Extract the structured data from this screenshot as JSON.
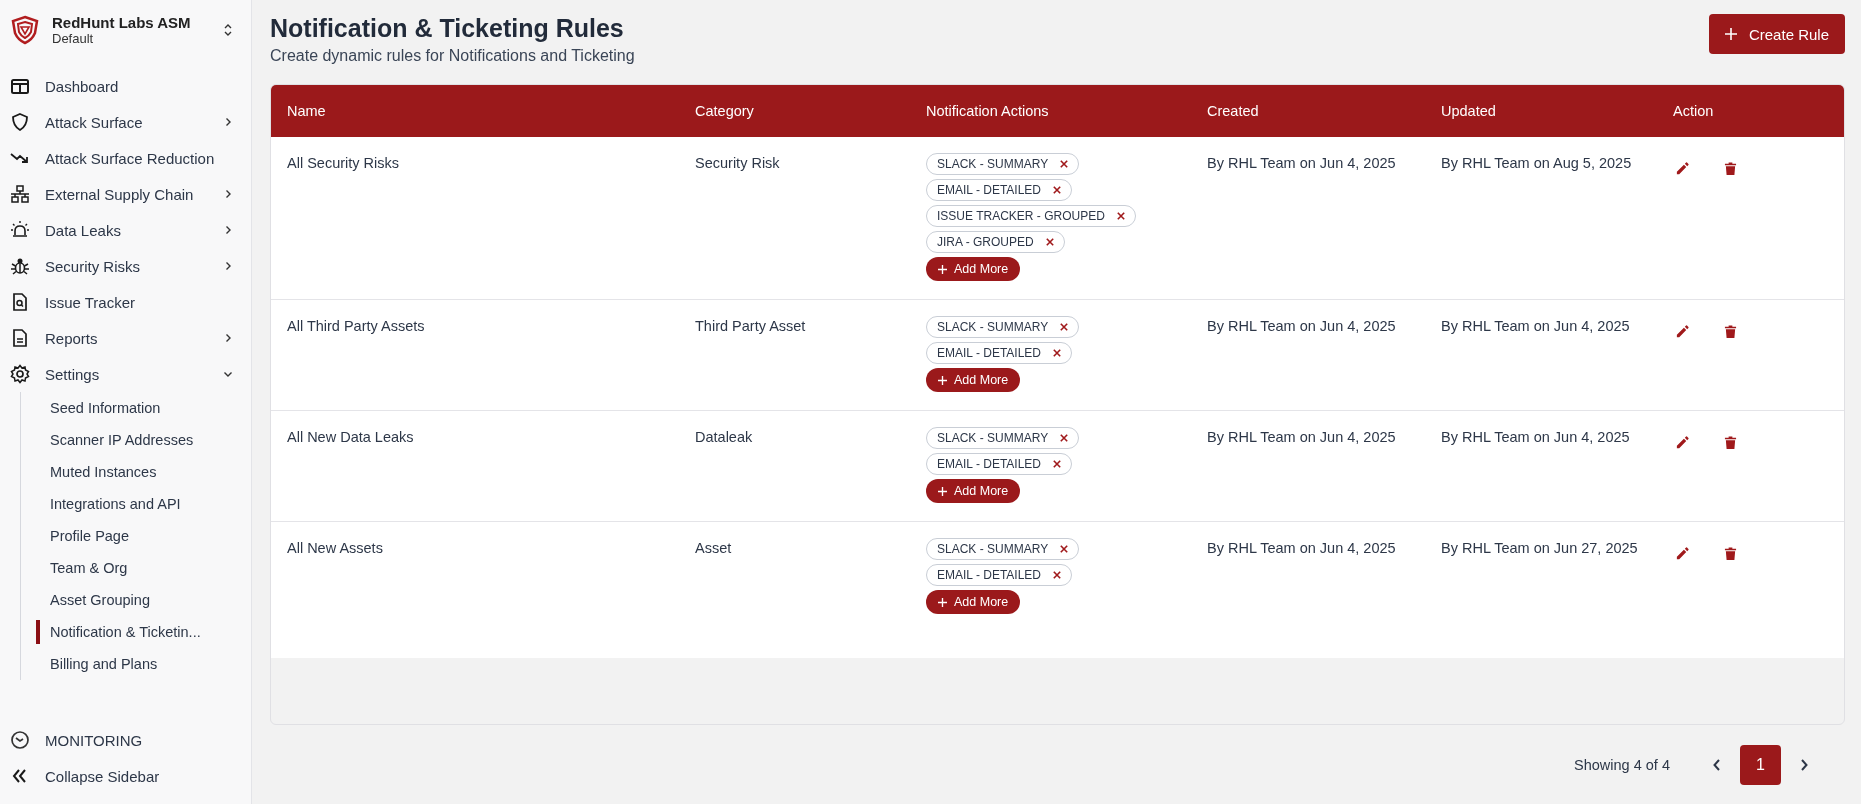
{
  "brand": {
    "name": "RedHunt Labs ASM",
    "workspace": "Default"
  },
  "sidebar": {
    "items": [
      {
        "label": "Dashboard",
        "kind": "link"
      },
      {
        "label": "Attack Surface",
        "kind": "group",
        "expanded": false
      },
      {
        "label": "Attack Surface Reduction",
        "kind": "link"
      },
      {
        "label": "External Supply Chain",
        "kind": "group",
        "expanded": false
      },
      {
        "label": "Data Leaks",
        "kind": "group",
        "expanded": false
      },
      {
        "label": "Security Risks",
        "kind": "group",
        "expanded": false
      },
      {
        "label": "Issue Tracker",
        "kind": "link"
      },
      {
        "label": "Reports",
        "kind": "group",
        "expanded": false
      },
      {
        "label": "Settings",
        "kind": "group",
        "expanded": true,
        "children": [
          {
            "label": "Seed Information",
            "selected": false
          },
          {
            "label": "Scanner IP Addresses",
            "selected": false
          },
          {
            "label": "Muted Instances",
            "selected": false
          },
          {
            "label": "Integrations and API",
            "selected": false
          },
          {
            "label": "Profile Page",
            "selected": false
          },
          {
            "label": "Team & Org",
            "selected": false
          },
          {
            "label": "Asset Grouping",
            "selected": false
          },
          {
            "label": "Notification & Ticketin...",
            "selected": true
          },
          {
            "label": "Billing and Plans",
            "selected": false
          }
        ]
      }
    ],
    "footer": [
      {
        "label": "MONITORING"
      },
      {
        "label": "Collapse Sidebar"
      }
    ]
  },
  "page": {
    "title": "Notification & Ticketing Rules",
    "subtitle": "Create dynamic rules for Notifications and Ticketing",
    "create_button": "Create Rule"
  },
  "table": {
    "columns": [
      "Name",
      "Category",
      "Notification Actions",
      "Created",
      "Updated",
      "Action"
    ],
    "rows": [
      {
        "name": "All Security Risks",
        "category": "Security Risk",
        "actions": [
          "SLACK - SUMMARY",
          "EMAIL - DETAILED",
          "ISSUE TRACKER - GROUPED",
          "JIRA - GROUPED"
        ],
        "add_button": "Add More",
        "created": "By RHL Team on Jun 4, 2025",
        "updated": "By RHL Team on Aug 5, 2025"
      },
      {
        "name": "All Third Party Assets",
        "category": "Third Party Asset",
        "actions": [
          "SLACK - SUMMARY",
          "EMAIL - DETAILED"
        ],
        "add_button": "Add More",
        "created": "By RHL Team on Jun 4, 2025",
        "updated": "By RHL Team on Jun 4, 2025"
      },
      {
        "name": "All New Data Leaks",
        "category": "Dataleak",
        "actions": [
          "SLACK - SUMMARY",
          "EMAIL - DETAILED"
        ],
        "add_button": "Add More",
        "created": "By RHL Team on Jun 4, 2025",
        "updated": "By RHL Team on Jun 4, 2025"
      },
      {
        "name": "All New Assets",
        "category": "Asset",
        "actions": [
          "SLACK - SUMMARY",
          "EMAIL - DETAILED"
        ],
        "add_button": "Add More",
        "created": "By RHL Team on Jun 4, 2025",
        "updated": "By RHL Team on Jun 27, 2025"
      }
    ]
  },
  "pagination": {
    "summary": "Showing 4 of 4",
    "pages": [
      {
        "label": "1",
        "selected": true
      }
    ]
  }
}
